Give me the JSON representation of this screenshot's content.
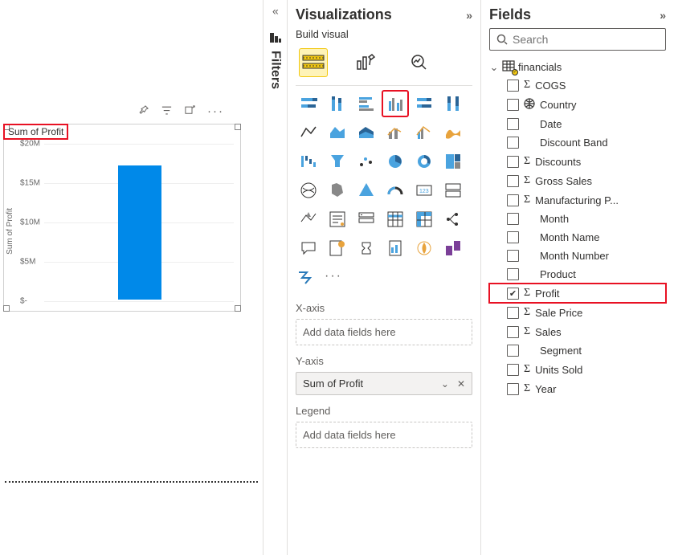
{
  "canvas": {
    "chart_title": "Sum of Profit",
    "yaxis_label": "Sum of Profit",
    "toolbar": {
      "pin": "📌",
      "filter": "filter",
      "focus": "focus",
      "more": "···"
    }
  },
  "chart_data": {
    "type": "bar",
    "categories": [
      ""
    ],
    "values": [
      17000000
    ],
    "title": "Sum of Profit",
    "xlabel": "",
    "ylabel": "Sum of Profit",
    "ylim": [
      0,
      20000000
    ],
    "yticks": [
      {
        "label": "$20M",
        "value": 20000000
      },
      {
        "label": "$15M",
        "value": 15000000
      },
      {
        "label": "$10M",
        "value": 10000000
      },
      {
        "label": "$5M",
        "value": 5000000
      },
      {
        "label": "$-",
        "value": 0
      }
    ]
  },
  "filters": {
    "label": "Filters"
  },
  "viz": {
    "header": "Visualizations",
    "sub": "Build visual",
    "wells": {
      "xaxis_label": "X-axis",
      "xaxis_placeholder": "Add data fields here",
      "yaxis_label": "Y-axis",
      "yaxis_value": "Sum of Profit",
      "legend_label": "Legend",
      "legend_placeholder": "Add data fields here"
    }
  },
  "fields": {
    "header": "Fields",
    "search_placeholder": "Search",
    "table": "financials",
    "rows": [
      {
        "checked": false,
        "sigma": true,
        "globe": false,
        "name": "COGS"
      },
      {
        "checked": false,
        "sigma": false,
        "globe": true,
        "name": "Country"
      },
      {
        "checked": false,
        "sigma": false,
        "globe": false,
        "name": "Date"
      },
      {
        "checked": false,
        "sigma": false,
        "globe": false,
        "name": "Discount Band"
      },
      {
        "checked": false,
        "sigma": true,
        "globe": false,
        "name": "Discounts"
      },
      {
        "checked": false,
        "sigma": true,
        "globe": false,
        "name": "Gross Sales"
      },
      {
        "checked": false,
        "sigma": true,
        "globe": false,
        "name": "Manufacturing P..."
      },
      {
        "checked": false,
        "sigma": false,
        "globe": false,
        "name": "Month"
      },
      {
        "checked": false,
        "sigma": false,
        "globe": false,
        "name": "Month Name"
      },
      {
        "checked": false,
        "sigma": false,
        "globe": false,
        "name": "Month Number"
      },
      {
        "checked": false,
        "sigma": false,
        "globe": false,
        "name": "Product"
      },
      {
        "checked": true,
        "sigma": true,
        "globe": false,
        "name": "Profit",
        "hl": true
      },
      {
        "checked": false,
        "sigma": true,
        "globe": false,
        "name": "Sale Price"
      },
      {
        "checked": false,
        "sigma": true,
        "globe": false,
        "name": "Sales"
      },
      {
        "checked": false,
        "sigma": false,
        "globe": false,
        "name": "Segment"
      },
      {
        "checked": false,
        "sigma": true,
        "globe": false,
        "name": "Units Sold"
      },
      {
        "checked": false,
        "sigma": true,
        "globe": false,
        "name": "Year"
      }
    ]
  }
}
